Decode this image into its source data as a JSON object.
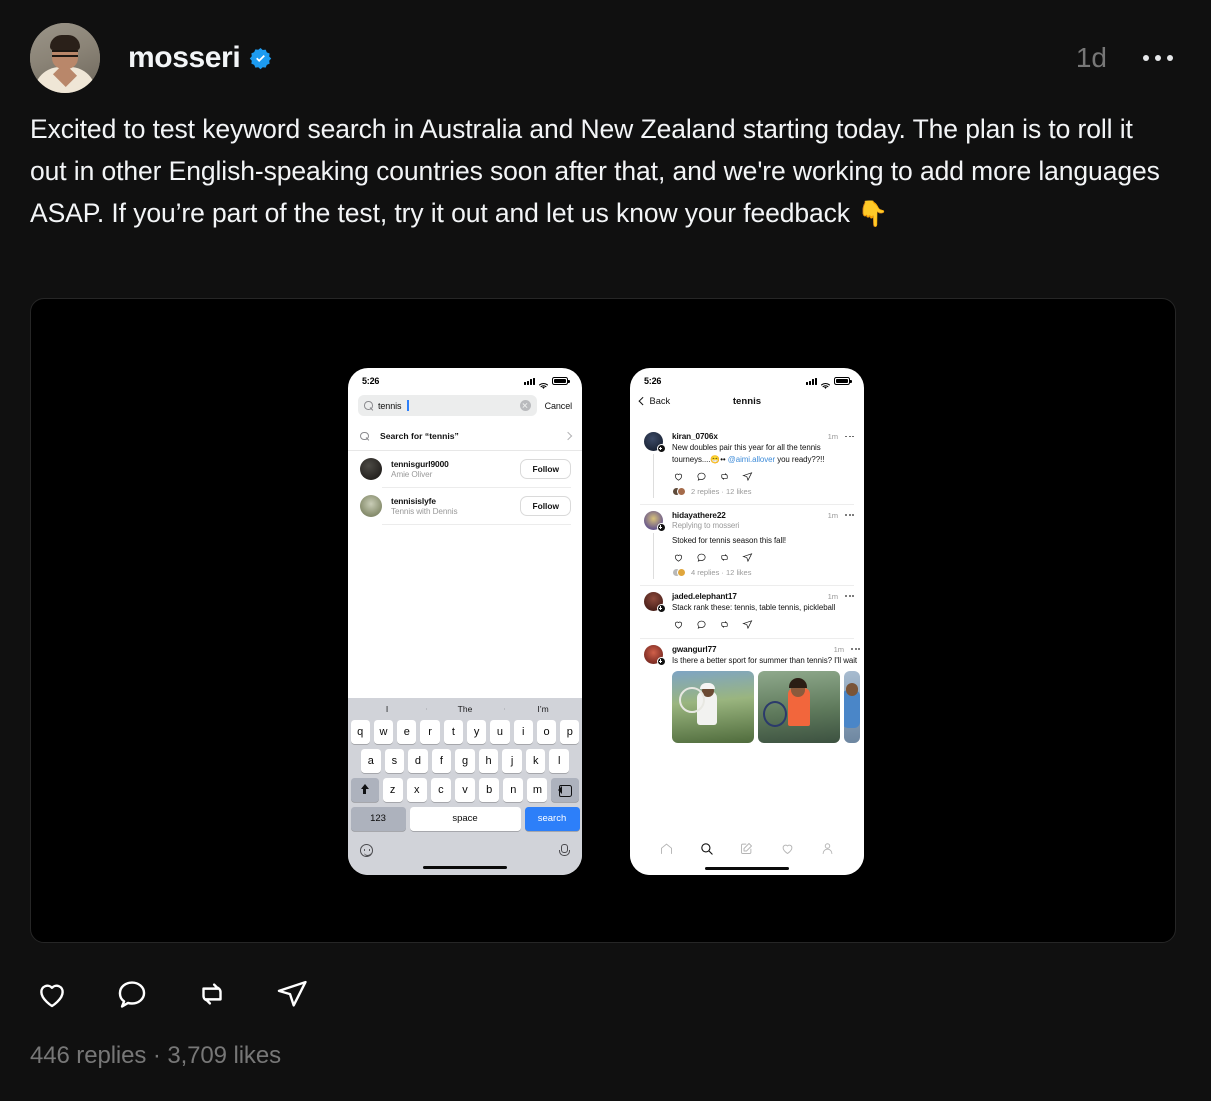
{
  "post": {
    "author": "mosseri",
    "verified": true,
    "timestamp": "1d",
    "more_label": "More options",
    "text": "Excited to test keyword search in Australia and New Zealand starting today. The plan is to roll it out in other English-speaking countries soon after that, and we're working to add more languages ASAP. If you’re part of the test, try it out and let us know your feedback ",
    "text_emoji": "👇",
    "replies_likes": "446 replies  ·  3,709 likes",
    "actions": [
      {
        "name": "like",
        "icon": "heart-icon"
      },
      {
        "name": "reply",
        "icon": "comment-icon"
      },
      {
        "name": "repost",
        "icon": "repost-icon"
      },
      {
        "name": "share",
        "icon": "share-icon"
      }
    ]
  },
  "media": {
    "left_phone": {
      "status": {
        "time": "5:26",
        "signal": "signal-icon",
        "wifi": "wifi-icon",
        "battery": "battery-icon"
      },
      "search": {
        "value": "tennis",
        "clear_label": "Clear",
        "cancel_label": "Cancel",
        "suggestion": "Search for “tennis”"
      },
      "results": [
        {
          "username": "tennisgurl9000",
          "fullname": "Amie Oliver",
          "action": "Follow"
        },
        {
          "username": "tennisislyfe",
          "fullname": "Tennis with Dennis",
          "action": "Follow"
        }
      ],
      "keyboard": {
        "predictions": [
          "I",
          "The",
          "I’m"
        ],
        "row1": [
          "q",
          "w",
          "e",
          "r",
          "t",
          "y",
          "u",
          "i",
          "o",
          "p"
        ],
        "row2": [
          "a",
          "s",
          "d",
          "f",
          "g",
          "h",
          "j",
          "k",
          "l"
        ],
        "row3": [
          "z",
          "x",
          "c",
          "v",
          "b",
          "n",
          "m"
        ],
        "shift": "shift-icon",
        "delete": "delete-icon",
        "numbers": "123",
        "space": "space",
        "submit": "search",
        "emoji": "emoji-icon",
        "mic": "microphone-icon"
      }
    },
    "right_phone": {
      "status": {
        "time": "5:26"
      },
      "nav": {
        "back": "Back",
        "title": "tennis"
      },
      "threads": [
        {
          "username": "kiran_0706x",
          "time": "1m",
          "text_before": "New doubles pair this year for all the tennis tourneys....😁•• ",
          "mention": "@aimi.allover",
          "text_after": " you ready??!!",
          "footer": "2 replies  ·  12 likes"
        },
        {
          "username": "hidayathere22",
          "time": "1m",
          "replying_to": "Replying to mosseri",
          "text_before": "Stoked for tennis season this fall!",
          "footer": "4 replies  ·  12 likes"
        },
        {
          "username": "jaded.elephant17",
          "time": "1m",
          "text_before": "Stack rank these: tennis, table tennis, pickleball"
        },
        {
          "username": "gwangurl77",
          "time": "1m",
          "text_before": "Is there a better sport for summer than tennis? I'll wait",
          "images": 3
        }
      ],
      "tabbar": [
        {
          "name": "home",
          "icon": "home-icon",
          "active": false
        },
        {
          "name": "search",
          "icon": "search-icon",
          "active": true
        },
        {
          "name": "compose",
          "icon": "compose-icon",
          "active": false
        },
        {
          "name": "activity",
          "icon": "heart-icon",
          "active": false
        },
        {
          "name": "profile",
          "icon": "person-icon",
          "active": false
        }
      ]
    }
  },
  "colors": {
    "page_bg": "#101010",
    "media_bg": "#000000",
    "text": "#f3f5f7",
    "muted": "#777777",
    "verified_blue": "#1d9bf0",
    "accent_blue": "#2d7ff9"
  }
}
